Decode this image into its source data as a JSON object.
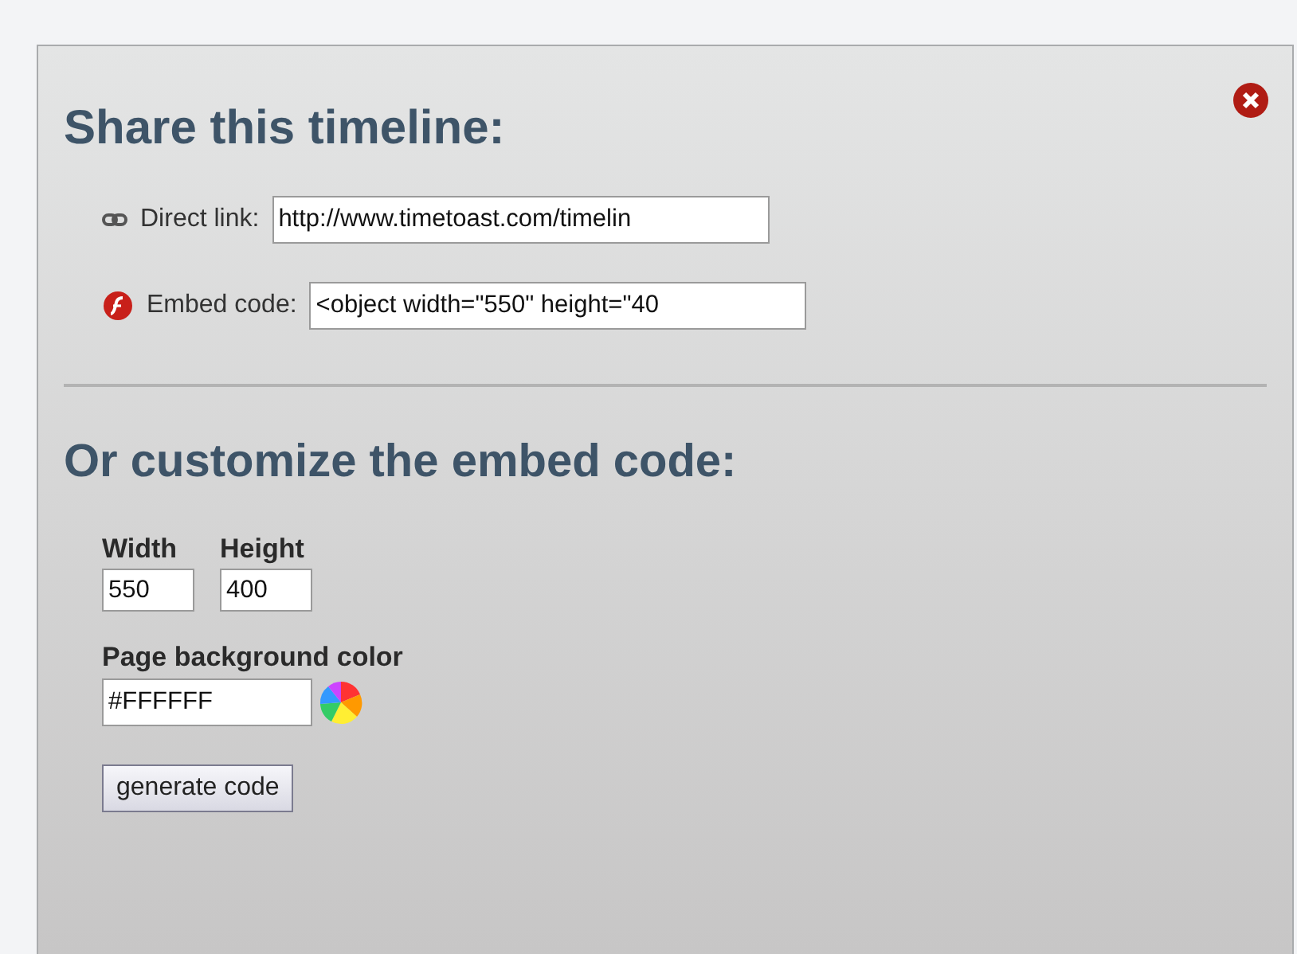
{
  "share": {
    "title": "Share this timeline:",
    "fields": [
      {
        "kind": "link",
        "label": "Direct link:",
        "value": "http://www.timetoast.com/timelin"
      },
      {
        "kind": "embed",
        "label": "Embed code:",
        "value": "<object width=\"550\" height=\"40"
      }
    ]
  },
  "customize": {
    "title": "Or customize the embed code:",
    "size_fields": [
      {
        "label": "Width",
        "value": "550"
      },
      {
        "label": "Height",
        "value": "400"
      }
    ],
    "color_field": {
      "label": "Page background color",
      "value": "#FFFFFF"
    },
    "button": "generate code"
  }
}
